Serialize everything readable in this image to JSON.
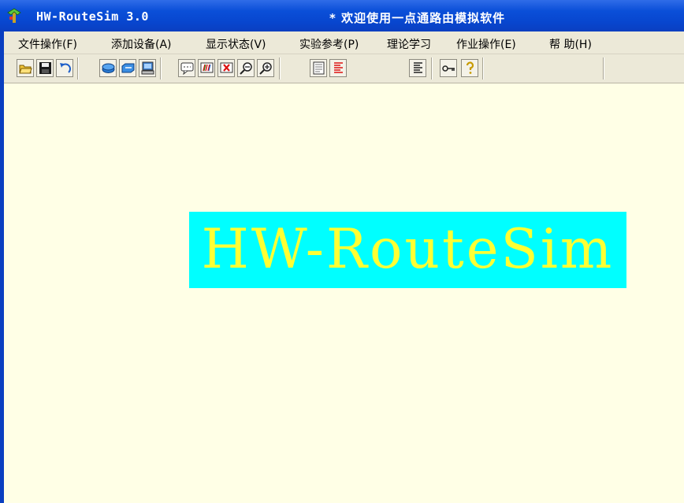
{
  "window": {
    "title": "HW-RouteSim 3.0",
    "welcome": "* 欢迎使用一点通路由模拟软件"
  },
  "menu": [
    "文件操作(F)",
    "添加设备(A)",
    "显示状态(V)",
    "实验参考(P)",
    "理论学习",
    "作业操作(E)",
    "帮 助(H)"
  ],
  "toolbar": {
    "icons": [
      "open-folder-icon",
      "save-disk-icon",
      "undo-icon",
      "router-icon",
      "switch-icon",
      "pc-icon",
      "console-icon",
      "ping-icon",
      "delete-icon",
      "zoom-out-icon",
      "zoom-in-icon",
      "document-icon",
      "red-document-icon",
      "lines-document-icon",
      "key-icon",
      "help-icon"
    ]
  },
  "splash": {
    "text": "HW-RouteSim"
  },
  "colors": {
    "splash_bg": "#00ffff",
    "splash_fg": "#ffff33",
    "canvas_bg": "#ffffe6",
    "titlebar": "#0a4fd8"
  }
}
